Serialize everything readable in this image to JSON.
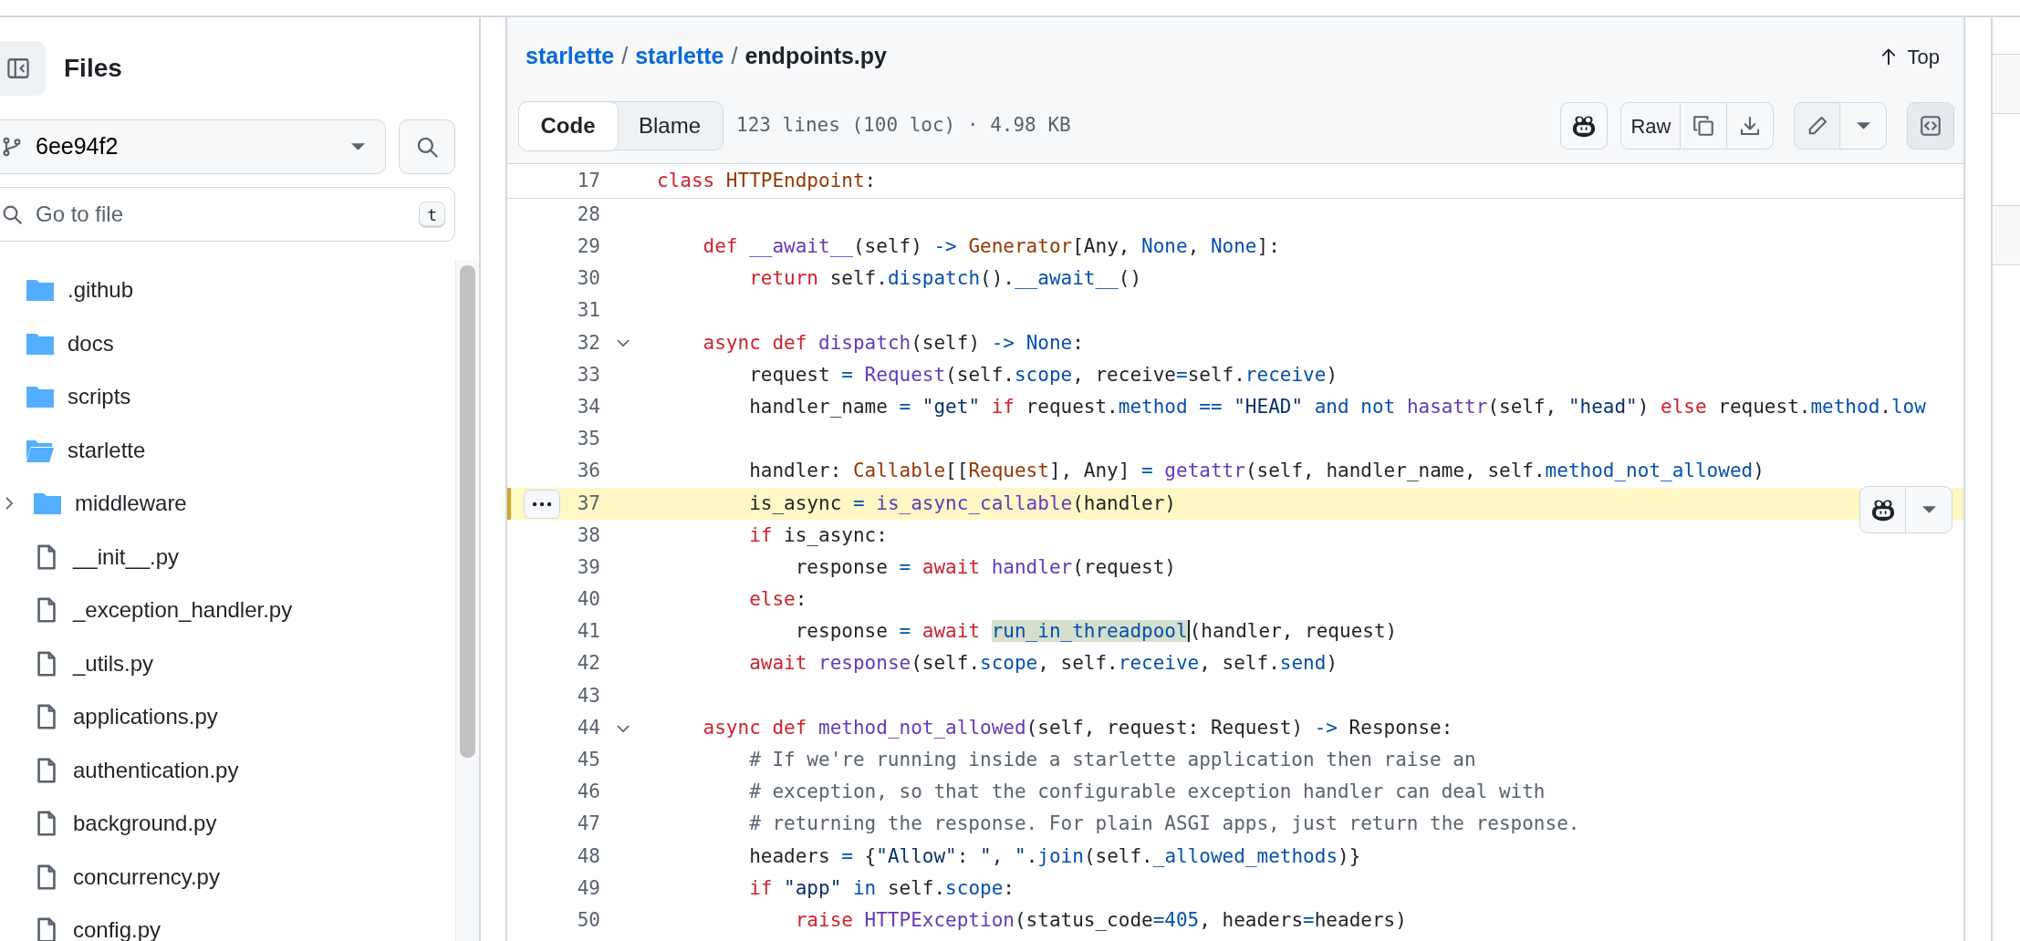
{
  "sidebar": {
    "title": "Files",
    "branch": "6ee94f2",
    "search": {
      "placeholder": "Go to file",
      "shortcut": "t"
    },
    "tree": [
      {
        "kind": "folder",
        "name": ".github",
        "expanded": false
      },
      {
        "kind": "folder",
        "name": "docs",
        "expanded": false
      },
      {
        "kind": "folder",
        "name": "scripts",
        "expanded": false
      },
      {
        "kind": "folder",
        "name": "starlette",
        "expanded": true,
        "children": [
          {
            "kind": "folder",
            "name": "middleware",
            "expanded": false
          },
          {
            "kind": "file",
            "name": "__init__.py"
          },
          {
            "kind": "file",
            "name": "_exception_handler.py"
          },
          {
            "kind": "file",
            "name": "_utils.py"
          },
          {
            "kind": "file",
            "name": "applications.py"
          },
          {
            "kind": "file",
            "name": "authentication.py"
          },
          {
            "kind": "file",
            "name": "background.py"
          },
          {
            "kind": "file",
            "name": "concurrency.py"
          },
          {
            "kind": "file",
            "name": "config.py"
          }
        ]
      }
    ]
  },
  "breadcrumb": [
    {
      "text": "starlette",
      "kind": "link"
    },
    {
      "text": "/",
      "kind": "sep"
    },
    {
      "text": "starlette",
      "kind": "link"
    },
    {
      "text": "/",
      "kind": "sep"
    },
    {
      "text": "endpoints.py",
      "kind": "current"
    }
  ],
  "top_button": "Top",
  "view_tabs": [
    {
      "label": "Code",
      "selected": true
    },
    {
      "label": "Blame",
      "selected": false
    }
  ],
  "file_info": "123 lines (100 loc) · 4.98 KB",
  "raw_button": "Raw",
  "sticky_line": {
    "n": "17",
    "tokens": [
      {
        "kind": "kw",
        "text": "class"
      },
      {
        "kind": "cls",
        "text": " HTTPEndpoint"
      },
      {
        "kind": "plain",
        "text": ":"
      }
    ]
  },
  "lines": [
    {
      "n": "28",
      "fold": false,
      "active": false
    },
    {
      "n": "29",
      "fold": false,
      "active": false,
      "tokens": [
        {
          "kind": "kw",
          "text": "    def"
        },
        {
          "kind": "fn",
          "text": " __await__"
        },
        {
          "kind": "plain",
          "text": "(self) "
        },
        {
          "kind": "const",
          "text": "->"
        },
        {
          "kind": "cls",
          "text": " Generator"
        },
        {
          "kind": "plain",
          "text": "[Any, "
        },
        {
          "kind": "const",
          "text": "None"
        },
        {
          "kind": "plain",
          "text": ", "
        },
        {
          "kind": "const",
          "text": "None"
        },
        {
          "kind": "plain",
          "text": "]:"
        }
      ]
    },
    {
      "n": "30",
      "fold": false,
      "active": false,
      "tokens": [
        {
          "kind": "kw",
          "text": "        return"
        },
        {
          "kind": "plain",
          "text": " self."
        },
        {
          "kind": "const",
          "text": "dispatch"
        },
        {
          "kind": "plain",
          "text": "()."
        },
        {
          "kind": "const",
          "text": "__await__"
        },
        {
          "kind": "plain",
          "text": "()"
        }
      ]
    },
    {
      "n": "31",
      "fold": false,
      "active": false
    },
    {
      "n": "32",
      "fold": true,
      "active": false,
      "tokens": [
        {
          "kind": "kw",
          "text": "    async def"
        },
        {
          "kind": "fn",
          "text": " dispatch"
        },
        {
          "kind": "plain",
          "text": "(self) "
        },
        {
          "kind": "const",
          "text": "->"
        },
        {
          "kind": "const",
          "text": " None"
        },
        {
          "kind": "plain",
          "text": ":"
        }
      ]
    },
    {
      "n": "33",
      "fold": false,
      "active": false,
      "tokens": [
        {
          "kind": "plain",
          "text": "        request "
        },
        {
          "kind": "const",
          "text": "="
        },
        {
          "kind": "fn",
          "text": " Request"
        },
        {
          "kind": "plain",
          "text": "(self."
        },
        {
          "kind": "const",
          "text": "scope"
        },
        {
          "kind": "plain",
          "text": ", receive"
        },
        {
          "kind": "const",
          "text": "="
        },
        {
          "kind": "plain",
          "text": "self."
        },
        {
          "kind": "const",
          "text": "receive"
        },
        {
          "kind": "plain",
          "text": ")"
        }
      ]
    },
    {
      "n": "34",
      "fold": false,
      "active": false,
      "tokens": [
        {
          "kind": "plain",
          "text": "        handler_name "
        },
        {
          "kind": "const",
          "text": "="
        },
        {
          "kind": "str",
          "text": " \"get\""
        },
        {
          "kind": "kw",
          "text": " if"
        },
        {
          "kind": "plain",
          "text": " request."
        },
        {
          "kind": "const",
          "text": "method"
        },
        {
          "kind": "const",
          "text": " =="
        },
        {
          "kind": "str",
          "text": " \"HEAD\""
        },
        {
          "kind": "const",
          "text": " and not"
        },
        {
          "kind": "fn",
          "text": " hasattr"
        },
        {
          "kind": "plain",
          "text": "(self, "
        },
        {
          "kind": "str",
          "text": "\"head\""
        },
        {
          "kind": "plain",
          "text": ") "
        },
        {
          "kind": "kw",
          "text": "else"
        },
        {
          "kind": "plain",
          "text": " request."
        },
        {
          "kind": "const",
          "text": "method"
        },
        {
          "kind": "plain",
          "text": "."
        },
        {
          "kind": "const",
          "text": "low"
        }
      ]
    },
    {
      "n": "35",
      "fold": false,
      "active": false
    },
    {
      "n": "36",
      "fold": false,
      "active": false,
      "tokens": [
        {
          "kind": "plain",
          "text": "        handler: "
        },
        {
          "kind": "cls",
          "text": "Callable"
        },
        {
          "kind": "plain",
          "text": "[["
        },
        {
          "kind": "cls",
          "text": "Request"
        },
        {
          "kind": "plain",
          "text": "], Any] "
        },
        {
          "kind": "const",
          "text": "="
        },
        {
          "kind": "fn",
          "text": " getattr"
        },
        {
          "kind": "plain",
          "text": "(self, handler_name, self."
        },
        {
          "kind": "const",
          "text": "method_not_allowed"
        },
        {
          "kind": "plain",
          "text": ")"
        }
      ]
    },
    {
      "n": "37",
      "fold": false,
      "active": true,
      "tokens": [
        {
          "kind": "plain",
          "text": "        is_async "
        },
        {
          "kind": "const",
          "text": "="
        },
        {
          "kind": "fn",
          "text": " is_async_callable"
        },
        {
          "kind": "plain",
          "text": "(handler)"
        }
      ]
    },
    {
      "n": "38",
      "fold": false,
      "active": false,
      "tokens": [
        {
          "kind": "kw",
          "text": "        if"
        },
        {
          "kind": "plain",
          "text": " is_async:"
        }
      ]
    },
    {
      "n": "39",
      "fold": false,
      "active": false,
      "tokens": [
        {
          "kind": "plain",
          "text": "            response "
        },
        {
          "kind": "const",
          "text": "="
        },
        {
          "kind": "kw",
          "text": " await"
        },
        {
          "kind": "fn",
          "text": " handler"
        },
        {
          "kind": "plain",
          "text": "(request)"
        }
      ]
    },
    {
      "n": "40",
      "fold": false,
      "active": false,
      "tokens": [
        {
          "kind": "kw",
          "text": "        else"
        },
        {
          "kind": "plain",
          "text": ":"
        }
      ]
    },
    {
      "n": "41",
      "fold": false,
      "active": false,
      "tokens": [
        {
          "kind": "plain",
          "text": "            response "
        },
        {
          "kind": "const",
          "text": "="
        },
        {
          "kind": "kw",
          "text": " await "
        },
        {
          "kind": "match",
          "text": "run_in_threadpool"
        },
        {
          "kind": "plain",
          "text": "(handler, request)"
        }
      ]
    },
    {
      "n": "42",
      "fold": false,
      "active": false,
      "tokens": [
        {
          "kind": "kw",
          "text": "        await"
        },
        {
          "kind": "fn",
          "text": " response"
        },
        {
          "kind": "plain",
          "text": "(self."
        },
        {
          "kind": "const",
          "text": "scope"
        },
        {
          "kind": "plain",
          "text": ", self."
        },
        {
          "kind": "const",
          "text": "receive"
        },
        {
          "kind": "plain",
          "text": ", self."
        },
        {
          "kind": "const",
          "text": "send"
        },
        {
          "kind": "plain",
          "text": ")"
        }
      ]
    },
    {
      "n": "43",
      "fold": false,
      "active": false
    },
    {
      "n": "44",
      "fold": true,
      "active": false,
      "tokens": [
        {
          "kind": "kw",
          "text": "    async def"
        },
        {
          "kind": "fn",
          "text": " method_not_allowed"
        },
        {
          "kind": "plain",
          "text": "(self, request: Request) "
        },
        {
          "kind": "const",
          "text": "->"
        },
        {
          "kind": "plain",
          "text": " Response:"
        }
      ]
    },
    {
      "n": "45",
      "fold": false,
      "active": false,
      "tokens": [
        {
          "kind": "cmt",
          "text": "        # If we're running inside a starlette application then raise an"
        }
      ]
    },
    {
      "n": "46",
      "fold": false,
      "active": false,
      "tokens": [
        {
          "kind": "cmt",
          "text": "        # exception, so that the configurable exception handler can deal with"
        }
      ]
    },
    {
      "n": "47",
      "fold": false,
      "active": false,
      "tokens": [
        {
          "kind": "cmt",
          "text": "        # returning the response. For plain ASGI apps, just return the response."
        }
      ]
    },
    {
      "n": "48",
      "fold": false,
      "active": false,
      "tokens": [
        {
          "kind": "plain",
          "text": "        headers "
        },
        {
          "kind": "const",
          "text": "="
        },
        {
          "kind": "plain",
          "text": " {"
        },
        {
          "kind": "str",
          "text": "\"Allow\""
        },
        {
          "kind": "plain",
          "text": ": "
        },
        {
          "kind": "str",
          "text": "\", \""
        },
        {
          "kind": "plain",
          "text": "."
        },
        {
          "kind": "const",
          "text": "join"
        },
        {
          "kind": "plain",
          "text": "(self."
        },
        {
          "kind": "const",
          "text": "_allowed_methods"
        },
        {
          "kind": "plain",
          "text": ")}"
        }
      ]
    },
    {
      "n": "49",
      "fold": false,
      "active": false,
      "tokens": [
        {
          "kind": "kw",
          "text": "        if"
        },
        {
          "kind": "str",
          "text": " \"app\""
        },
        {
          "kind": "const",
          "text": " in"
        },
        {
          "kind": "plain",
          "text": " self."
        },
        {
          "kind": "const",
          "text": "scope"
        },
        {
          "kind": "plain",
          "text": ":"
        }
      ]
    },
    {
      "n": "50",
      "fold": false,
      "active": false,
      "tokens": [
        {
          "kind": "kw",
          "text": "            raise"
        },
        {
          "kind": "fn",
          "text": " HTTPException"
        },
        {
          "kind": "plain",
          "text": "(status_code"
        },
        {
          "kind": "const",
          "text": "="
        },
        {
          "kind": "const",
          "text": "405"
        },
        {
          "kind": "plain",
          "text": ", headers"
        },
        {
          "kind": "const",
          "text": "="
        },
        {
          "kind": "plain",
          "text": "headers)"
        }
      ]
    }
  ]
}
